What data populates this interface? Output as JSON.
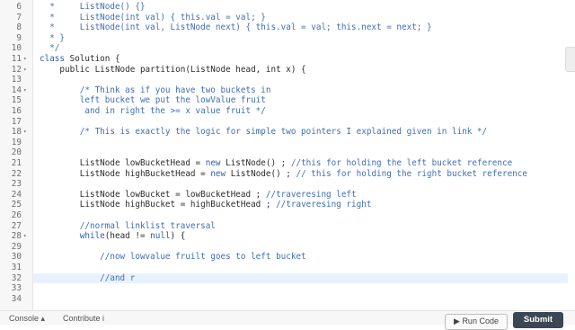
{
  "editor": {
    "lines": [
      {
        "num": "6",
        "fold": "",
        "segs": [
          {
            "t": "  *     ListNode() {}",
            "c": "cm"
          }
        ]
      },
      {
        "num": "7",
        "fold": "",
        "segs": [
          {
            "t": "  *     ListNode(int val) { this.val = val; }",
            "c": "cm"
          }
        ]
      },
      {
        "num": "8",
        "fold": "",
        "segs": [
          {
            "t": "  *     ListNode(int val, ListNode next) { this.val = val; this.next = next; }",
            "c": "cm"
          }
        ]
      },
      {
        "num": "9",
        "fold": "",
        "segs": [
          {
            "t": "  * }",
            "c": "cm"
          }
        ]
      },
      {
        "num": "10",
        "fold": "",
        "segs": [
          {
            "t": "  */",
            "c": "cm"
          }
        ]
      },
      {
        "num": "11",
        "fold": "▾",
        "segs": [
          {
            "t": "class ",
            "c": "kw"
          },
          {
            "t": "Solution {",
            "c": ""
          }
        ]
      },
      {
        "num": "12",
        "fold": "▾",
        "segs": [
          {
            "t": "    public ListNode partition(ListNode head, int x) {",
            "c": ""
          }
        ]
      },
      {
        "num": "13",
        "fold": "",
        "segs": []
      },
      {
        "num": "14",
        "fold": "▾",
        "segs": [
          {
            "t": "        /* Think as if you have two buckets in",
            "c": "cm"
          }
        ]
      },
      {
        "num": "15",
        "fold": "",
        "segs": [
          {
            "t": "        left bucket we put the lowValue fruit",
            "c": "cm"
          }
        ]
      },
      {
        "num": "16",
        "fold": "",
        "segs": [
          {
            "t": "         and in right the >= x value fruit */",
            "c": "cm"
          }
        ]
      },
      {
        "num": "17",
        "fold": "",
        "segs": []
      },
      {
        "num": "18",
        "fold": "▾",
        "segs": [
          {
            "t": "        /* This is exactly the logic for simple two pointers I explained given in link */",
            "c": "cm"
          }
        ]
      },
      {
        "num": "19",
        "fold": "",
        "segs": []
      },
      {
        "num": "20",
        "fold": "",
        "segs": []
      },
      {
        "num": "21",
        "fold": "",
        "segs": [
          {
            "t": "        ListNode lowBucketHead = ",
            "c": ""
          },
          {
            "t": "new",
            "c": "kw"
          },
          {
            "t": " ListNode() ; ",
            "c": ""
          },
          {
            "t": "//this for holding the left bucket reference",
            "c": "cm"
          }
        ]
      },
      {
        "num": "22",
        "fold": "",
        "segs": [
          {
            "t": "        ListNode highBucketHead = ",
            "c": ""
          },
          {
            "t": "new",
            "c": "kw"
          },
          {
            "t": " ListNode() ; ",
            "c": ""
          },
          {
            "t": "// this for holding the right bucket reference",
            "c": "cm"
          }
        ]
      },
      {
        "num": "23",
        "fold": "",
        "segs": []
      },
      {
        "num": "24",
        "fold": "",
        "segs": [
          {
            "t": "        ListNode lowBucket = lowBucketHead ; ",
            "c": ""
          },
          {
            "t": "//traveresing left",
            "c": "cm"
          }
        ]
      },
      {
        "num": "25",
        "fold": "",
        "segs": [
          {
            "t": "        ListNode highBucket = highBucketHead ; ",
            "c": ""
          },
          {
            "t": "//traveresing right",
            "c": "cm"
          }
        ]
      },
      {
        "num": "26",
        "fold": "",
        "segs": []
      },
      {
        "num": "27",
        "fold": "",
        "segs": [
          {
            "t": "        //normal linklist traversal",
            "c": "cm"
          }
        ]
      },
      {
        "num": "28",
        "fold": "▾",
        "segs": [
          {
            "t": "        ",
            "c": ""
          },
          {
            "t": "while",
            "c": "kw"
          },
          {
            "t": "(head != ",
            "c": ""
          },
          {
            "t": "null",
            "c": "kw"
          },
          {
            "t": ") {",
            "c": ""
          }
        ]
      },
      {
        "num": "29",
        "fold": "",
        "segs": []
      },
      {
        "num": "30",
        "fold": "",
        "segs": [
          {
            "t": "            //now lowvalue fruilt goes to left bucket",
            "c": "cm"
          }
        ]
      },
      {
        "num": "31",
        "fold": "",
        "segs": []
      },
      {
        "num": "32",
        "fold": "",
        "segs": [
          {
            "t": "            //and r",
            "c": "cm"
          }
        ],
        "active": true
      },
      {
        "num": "33",
        "fold": "",
        "segs": []
      },
      {
        "num": "34",
        "fold": "",
        "segs": []
      }
    ]
  },
  "bottombar": {
    "console_label": "Console ▴",
    "contribute_label": "Contribute i",
    "run_label": "▶ Run Code",
    "submit_label": "Submit"
  }
}
